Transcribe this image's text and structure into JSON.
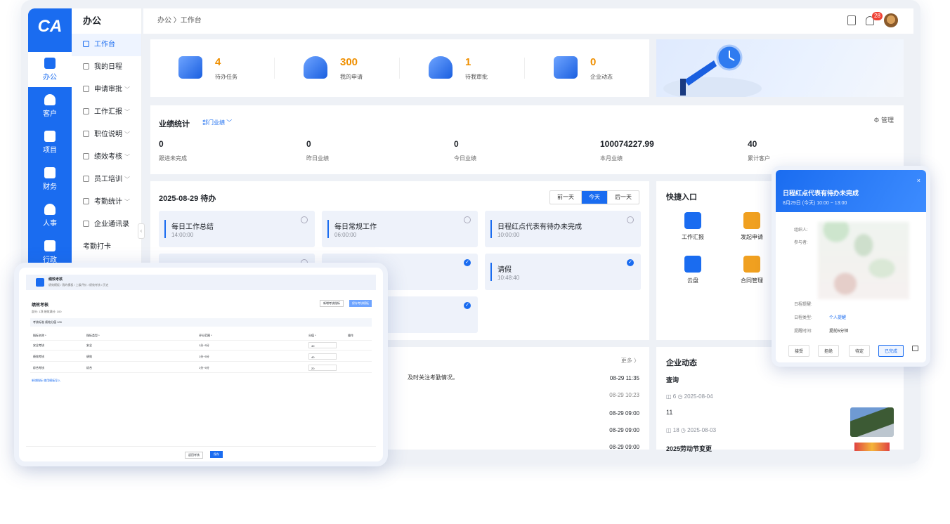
{
  "rail": {
    "items": [
      {
        "label": "办公",
        "icon": "briefcase-icon"
      },
      {
        "label": "客户",
        "icon": "person-icon"
      },
      {
        "label": "项目",
        "icon": "folder-icon"
      },
      {
        "label": "财务",
        "icon": "wallet-icon"
      },
      {
        "label": "人事",
        "icon": "person-add-icon"
      },
      {
        "label": "行政",
        "icon": "home-icon"
      }
    ]
  },
  "menu": {
    "title": "办公",
    "items": [
      {
        "label": "工作台"
      },
      {
        "label": "我的日程"
      },
      {
        "label": "申请审批",
        "chevron": "﹀"
      },
      {
        "label": "工作汇报",
        "chevron": "﹀"
      },
      {
        "label": "职位说明",
        "chevron": "﹀"
      },
      {
        "label": "绩效考核",
        "chevron": "﹀"
      },
      {
        "label": "员工培训",
        "chevron": "﹀"
      },
      {
        "label": "考勤统计",
        "chevron": "﹀"
      },
      {
        "label": "企业通讯录"
      },
      {
        "label": "考勤打卡"
      }
    ],
    "collapse_glyph": "‹"
  },
  "topbar": {
    "breadcrumb": "办公 〉工作台",
    "notif_count": "28"
  },
  "stats": [
    {
      "value": "4",
      "label": "待办任务"
    },
    {
      "value": "300",
      "label": "我的申请"
    },
    {
      "value": "1",
      "label": "待我审批"
    },
    {
      "value": "0",
      "label": "企业动态"
    }
  ],
  "performance": {
    "title": "业绩统计",
    "dept_filter": "部门业绩 ﹀",
    "manage": "⚙ 管理",
    "items": [
      {
        "value": "0",
        "label": "跟进未完成"
      },
      {
        "value": "0",
        "label": "昨日业绩"
      },
      {
        "value": "0",
        "label": "今日业绩"
      },
      {
        "value": "100074227.99",
        "label": "本月业绩"
      },
      {
        "value": "40",
        "label": "累计客户"
      }
    ]
  },
  "todo": {
    "title": "2025-08-29 待办",
    "buttons": [
      "前一天",
      "今天",
      "后一天"
    ],
    "cards": [
      {
        "title": "每日工作总结",
        "time": "14:00:00",
        "done": false
      },
      {
        "title": "每日常规工作",
        "time": "06:00:00",
        "done": false
      },
      {
        "title": "日程红点代表有待办未完成",
        "time": "10:00:00",
        "done": false
      },
      {
        "title": "请假",
        "time": "10:48:40",
        "done": true
      }
    ],
    "check": "✓"
  },
  "quick": {
    "title": "快捷入口",
    "items": [
      {
        "label": "工作汇报",
        "color": "#1a6cf0"
      },
      {
        "label": "发起申请",
        "color": "#f0a020"
      },
      {
        "label": "云盘",
        "color": "#1a6cf0"
      },
      {
        "label": "合同管理",
        "color": "#f0a020"
      }
    ]
  },
  "news": {
    "more": "更多 〉",
    "text": "及时关注考勤情况。",
    "times": [
      "08-29 11:35",
      "08-29 10:23",
      "08-29 09:00",
      "08-29 09:00",
      "08-29 09:00"
    ]
  },
  "corp": {
    "title": "企业动态",
    "posts": [
      {
        "title": "查询",
        "meta": "◫ 6  ◷ 2025-08-04"
      },
      {
        "title": "11",
        "meta": "◫ 18  ◷ 2025-08-03"
      },
      {
        "title": "2025劳动节变更",
        "meta": ""
      }
    ]
  },
  "tablet": {
    "title": "绩效考核",
    "nav": "绩效模板  /  我的模板  /  上级评价  /  绩效考核  /  历史",
    "page_title": "绩效考核",
    "meta": "部分: 1项   绩效满分: 100",
    "btn1": "新增考核指标",
    "btn2": "保存考核模板",
    "band": "考核标准   绩效分值   100",
    "rows": [
      {
        "name": "安全考核",
        "type": "安全",
        "scope": "1分~5分",
        "value": "40"
      },
      {
        "name": "绩效考核",
        "type": "绩效",
        "scope": "1分~5分",
        "value": "40"
      },
      {
        "name": "综合考核",
        "type": "综合",
        "scope": "1分~5分",
        "value": "20"
      }
    ],
    "header": [
      "指标名称 *",
      "指标类型 *",
      "评分范围 *",
      "分值 *",
      "操作"
    ],
    "link": "新增指标   使用模板导入",
    "foot_cancel": "返回考核",
    "foot_save": "保存"
  },
  "popup": {
    "title": "日程红点代表有待办未完成",
    "time": "8月29日 (今天) 10:00 ~ 13:00",
    "close": "×",
    "labels": {
      "organizer": "组织人:",
      "participants": "参与者:",
      "remind_type": "日程提醒:",
      "schedule_type": "日程类型:",
      "remind_time": "提醒时间:"
    },
    "schedule_type": "个人提醒",
    "remind_time": "提前5分钟",
    "buttons": [
      "接受",
      "拒绝",
      "待定",
      "已完成"
    ]
  }
}
